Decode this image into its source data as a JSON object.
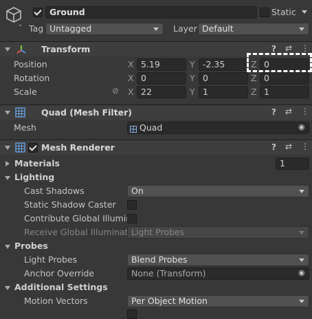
{
  "object": {
    "name": "Ground",
    "static_label": "Static",
    "tag_label": "Tag",
    "tag_value": "Untagged",
    "layer_label": "Layer",
    "layer_value": "Default"
  },
  "transform": {
    "title": "Transform",
    "position_label": "Position",
    "rotation_label": "Rotation",
    "scale_label": "Scale",
    "axis_x": "X",
    "axis_y": "Y",
    "axis_z": "Z",
    "position": {
      "x": "5.19",
      "y": "-2.35",
      "z": "0"
    },
    "rotation": {
      "x": "0",
      "y": "0",
      "z": "0"
    },
    "scale": {
      "x": "22",
      "y": "1",
      "z": "1"
    }
  },
  "mesh_filter": {
    "title": "Quad (Mesh Filter)",
    "mesh_label": "Mesh",
    "mesh_value": "Quad"
  },
  "mesh_renderer": {
    "title": "Mesh Renderer",
    "materials_label": "Materials",
    "materials_count": "1",
    "lighting_label": "Lighting",
    "cast_shadows_label": "Cast Shadows",
    "cast_shadows_value": "On",
    "static_shadow_caster_label": "Static Shadow Caster",
    "contribute_gi_label": "Contribute Global Illuminati",
    "receive_gi_label": "Receive Global Illuminatio",
    "receive_gi_value": "Light Probes",
    "probes_label": "Probes",
    "light_probes_label": "Light Probes",
    "light_probes_value": "Blend Probes",
    "anchor_override_label": "Anchor Override",
    "anchor_override_value": "None (Transform)",
    "additional_settings_label": "Additional Settings",
    "motion_vectors_label": "Motion Vectors",
    "motion_vectors_value": "Per Object Motion"
  },
  "icons": {
    "help": "?",
    "presets": "⇄",
    "more": "⋮",
    "link": "⊘",
    "object_picker": "◉"
  }
}
